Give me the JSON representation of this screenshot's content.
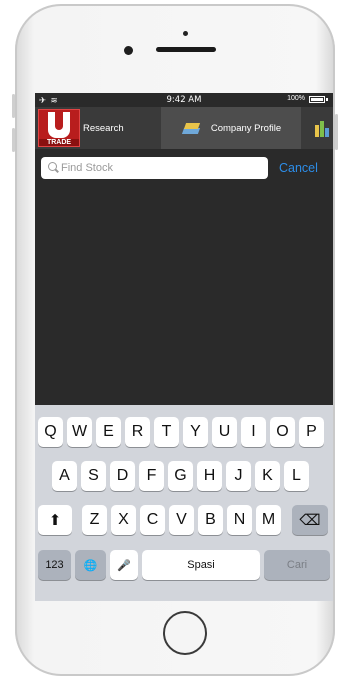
{
  "statusbar": {
    "left": "✈ ≋",
    "time": "9:42 AM",
    "battery": "100%"
  },
  "logo": {
    "text": "TRADE"
  },
  "tabs": {
    "research": "Research",
    "profile": "Company Profile"
  },
  "search": {
    "placeholder": "Find Stock",
    "cancel_label": "Cancel"
  },
  "keyboard": {
    "row1": [
      "Q",
      "W",
      "E",
      "R",
      "T",
      "Y",
      "U",
      "I",
      "O",
      "P"
    ],
    "row2": [
      "A",
      "S",
      "D",
      "F",
      "G",
      "H",
      "J",
      "K",
      "L"
    ],
    "row3": [
      "Z",
      "X",
      "C",
      "V",
      "B",
      "N",
      "M"
    ],
    "numbers_label": "123",
    "space_label": "Spasi",
    "go_label": "Cari",
    "shift_glyph": "⬆",
    "delete_glyph": "⌫",
    "globe_glyph": "🌐",
    "mic_glyph": "🎤"
  },
  "icons": [
    "camera-icon",
    "speaker-icon",
    "airplane-icon",
    "wifi-icon",
    "battery-icon",
    "logo-icon",
    "company-profile-icon",
    "chart-tab-icon",
    "search-icon",
    "shift-icon",
    "delete-icon",
    "globe-icon",
    "microphone-icon"
  ],
  "colors": {
    "accent": "#2d8de8",
    "logo": "#b81d1d",
    "keyboard_bg": "#d2d5db"
  }
}
